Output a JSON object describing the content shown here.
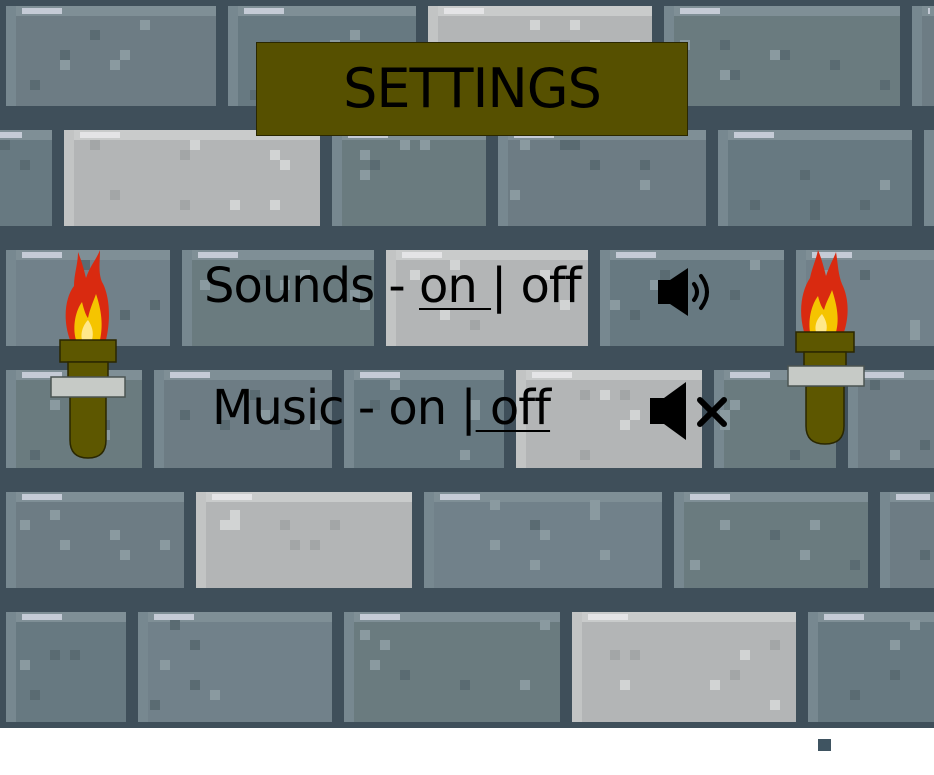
{
  "screen": {
    "title": "SETTINGS"
  },
  "options": {
    "sounds": {
      "label": "Sounds",
      "dash": " - ",
      "on": "on ",
      "separator": "|",
      "off": " off",
      "state": "on",
      "icon": "speaker-on-icon"
    },
    "music": {
      "label": "Music",
      "dash": " - ",
      "on": "on ",
      "separator": "|",
      "off": " off",
      "state": "off",
      "icon": "speaker-muted-icon"
    }
  },
  "colors": {
    "panel": "#565000",
    "torch_handle": "#5d5700",
    "flame_outer": "#d92a10",
    "flame_inner": "#f5c400",
    "mortar": "#3f4f5a",
    "brick_dark": "#6a7b82",
    "brick_light": "#b1b3b4"
  }
}
